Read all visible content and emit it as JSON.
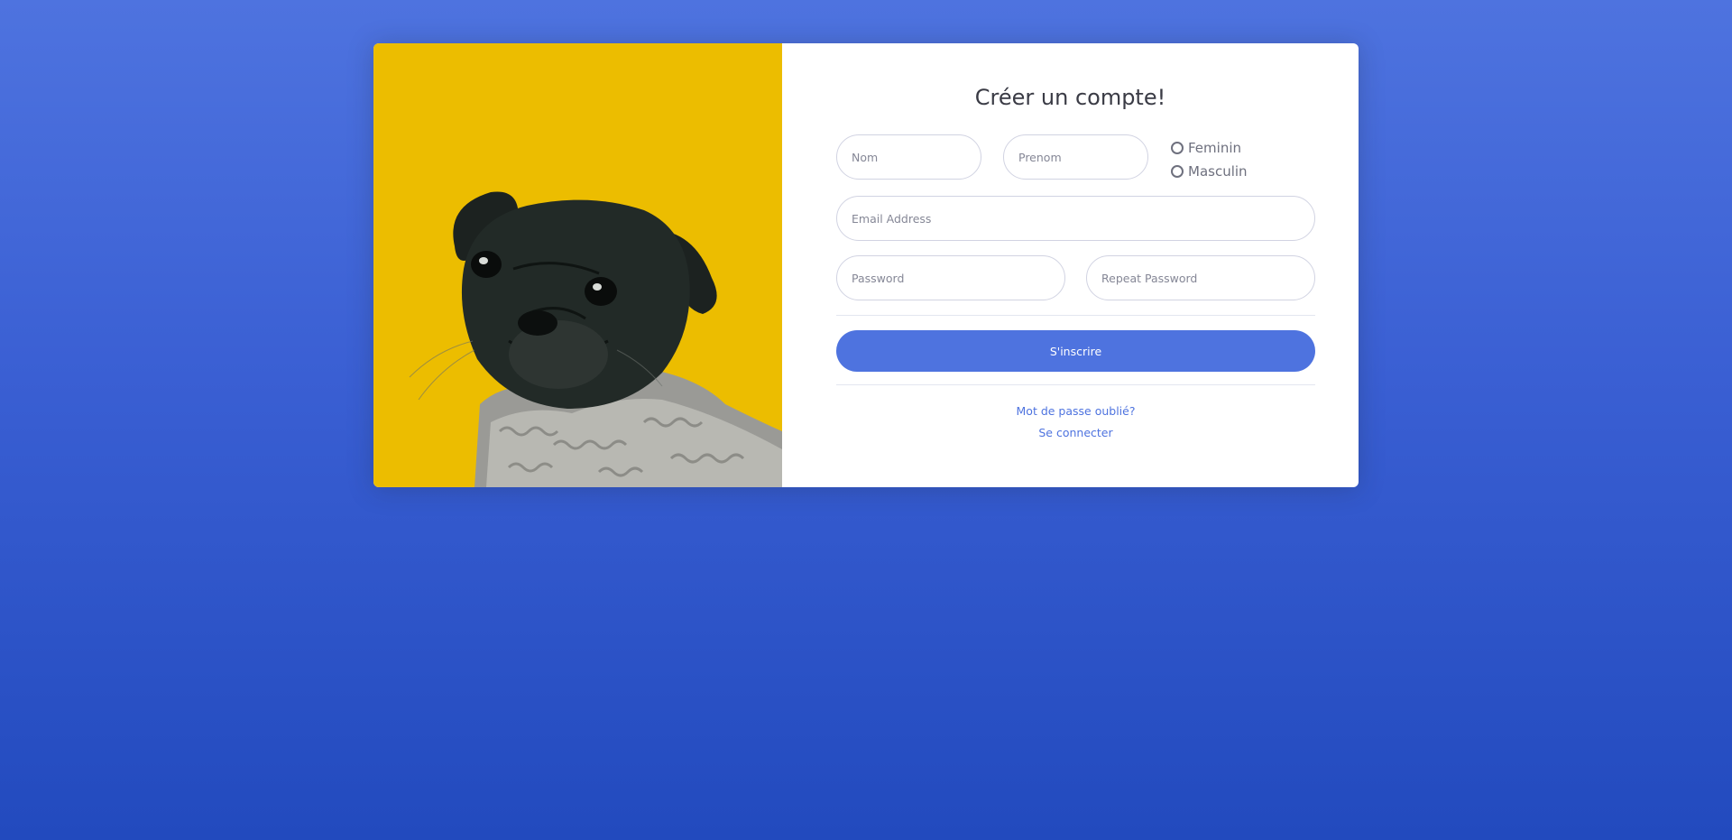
{
  "form": {
    "title": "Créer un compte!",
    "nom_placeholder": "Nom",
    "prenom_placeholder": "Prenom",
    "gender_options": [
      "Feminin",
      "Masculin"
    ],
    "email_placeholder": "Email Address",
    "password_placeholder": "Password",
    "repeat_password_placeholder": "Repeat Password",
    "submit_label": "S'inscrire",
    "forgot_password_link": "Mot de passe oublié?",
    "login_link": "Se connecter"
  },
  "colors": {
    "accent": "#4e73df",
    "image_background": "#ecbd00",
    "background_top": "#4e73df",
    "background_bottom": "#224abe"
  },
  "image": {
    "subject": "pug-in-sweater-photo"
  }
}
